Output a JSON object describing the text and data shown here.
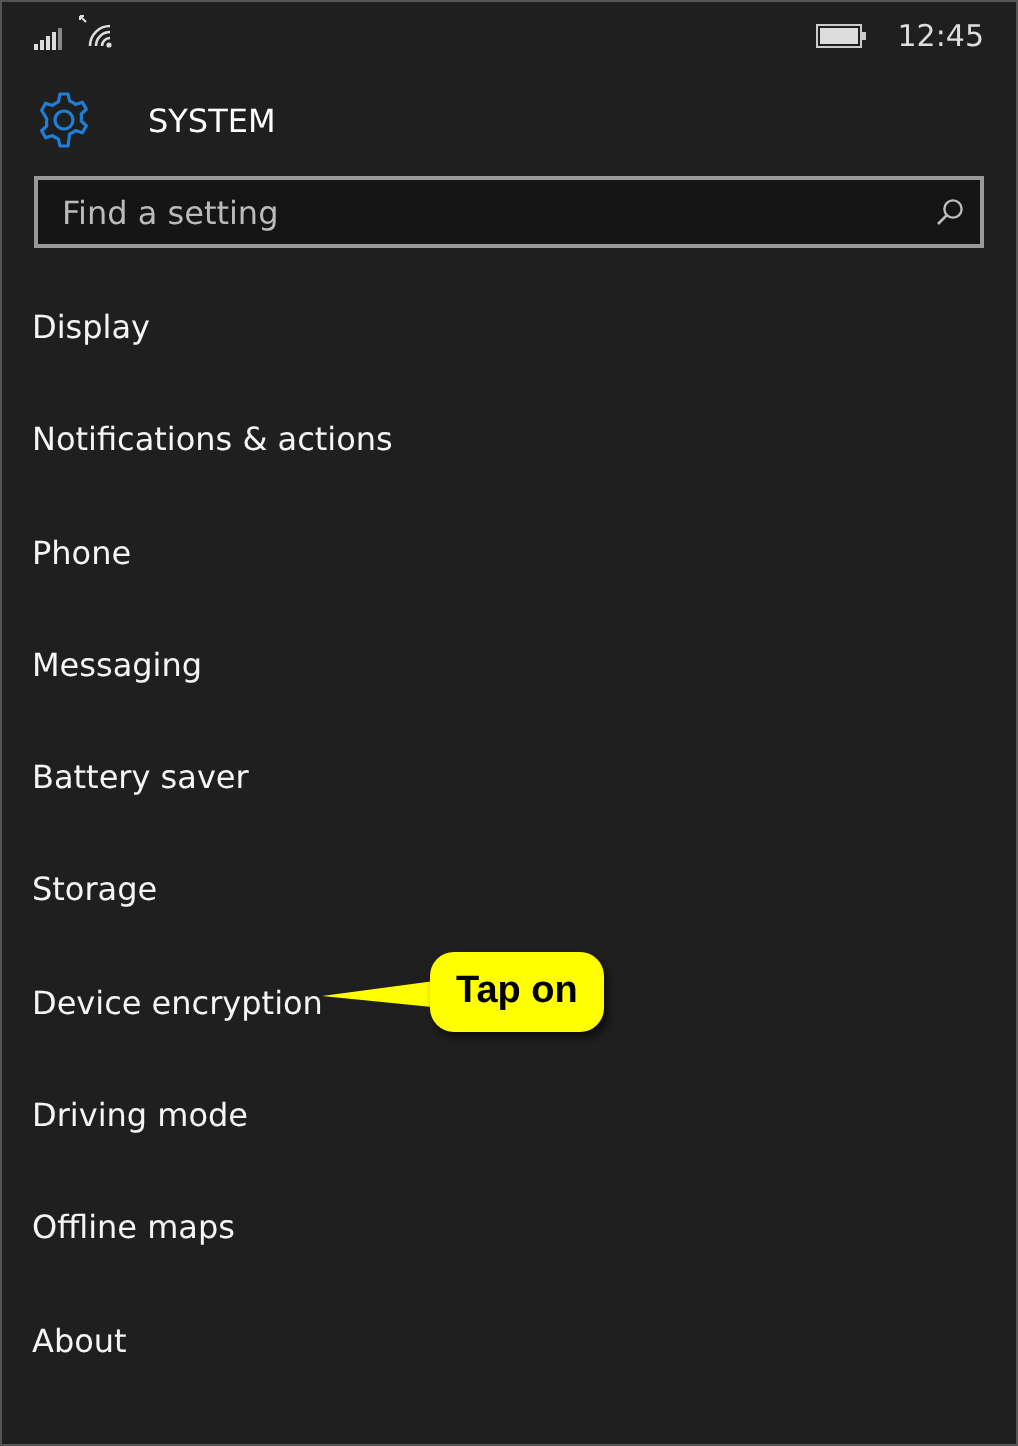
{
  "status_bar": {
    "time": "12:45"
  },
  "header": {
    "title": "SYSTEM"
  },
  "search": {
    "placeholder": "Find a setting"
  },
  "items": [
    {
      "label": "Display"
    },
    {
      "label": "Notifications & actions"
    },
    {
      "label": "Phone"
    },
    {
      "label": "Messaging"
    },
    {
      "label": "Battery saver"
    },
    {
      "label": "Storage"
    },
    {
      "label": "Device encryption",
      "callout": "Tap on"
    },
    {
      "label": "Driving mode"
    },
    {
      "label": "Offline maps"
    },
    {
      "label": "About"
    }
  ]
}
